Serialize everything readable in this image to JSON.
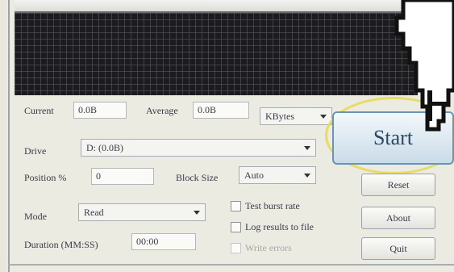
{
  "metrics": {
    "current_label": "Current",
    "current_value": "0.0B",
    "average_label": "Average",
    "average_value": "0.0B",
    "unit_selected": "KBytes"
  },
  "drive": {
    "label": "Drive",
    "selected": "D: (0.0B)"
  },
  "position": {
    "label": "Position %",
    "value": "0"
  },
  "block_size": {
    "label": "Block Size",
    "selected": "Auto"
  },
  "mode": {
    "label": "Mode",
    "selected": "Read"
  },
  "duration": {
    "label": "Duration (MM:SS)",
    "value": "00:00"
  },
  "options": {
    "test_burst_label": "Test burst rate",
    "log_label": "Log results to file",
    "write_label": "Write errors"
  },
  "buttons": {
    "start": "Start",
    "reset": "Reset",
    "about": "About",
    "quit": "Quit"
  },
  "colors": {
    "graph_bg": "#1c1c1e",
    "start_accent": "#6c93b3",
    "highlight_ring": "#e6dc66"
  },
  "icons": {
    "cursor": "pointer-cursor-icon"
  }
}
